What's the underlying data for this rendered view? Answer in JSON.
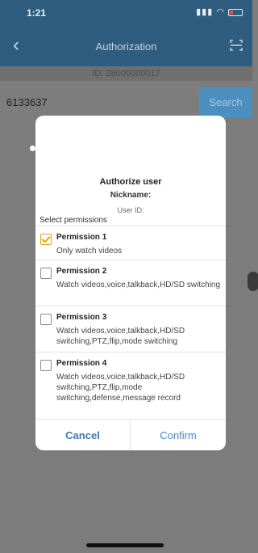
{
  "status_bar": {
    "time": "1:21",
    "icons": [
      "signal-icon",
      "wifi-icon",
      "battery-icon"
    ]
  },
  "nav": {
    "title": "Authorization",
    "back_icon": "chevron-left-icon",
    "right_icon": "scan-icon"
  },
  "device_id_text": "ID: 28000000017",
  "search": {
    "value": "6133637",
    "button_label": "Search"
  },
  "dialog": {
    "title": "Authorize user",
    "nickname_label": "Nickname:",
    "user_id_label": "User ID:",
    "select_label": "Select permissions",
    "permissions": [
      {
        "name": "Permission 1",
        "description": "Only watch videos",
        "checked": true
      },
      {
        "name": "Permission 2",
        "description": "Watch videos,voice,talkback,HD/SD switching",
        "checked": false
      },
      {
        "name": "Permission 3",
        "description": "Watch videos,voice,talkback,HD/SD switching,PTZ,flip,mode switching",
        "checked": false
      },
      {
        "name": "Permission 4",
        "description": "Watch videos,voice,talkback,HD/SD switching,PTZ,flip,mode switching,defense,message record",
        "checked": false
      }
    ],
    "cancel_label": "Cancel",
    "confirm_label": "Confirm"
  },
  "colors": {
    "nav_bg": "#2f5d80",
    "accent": "#4a86c4",
    "check": "#e0a81c"
  }
}
